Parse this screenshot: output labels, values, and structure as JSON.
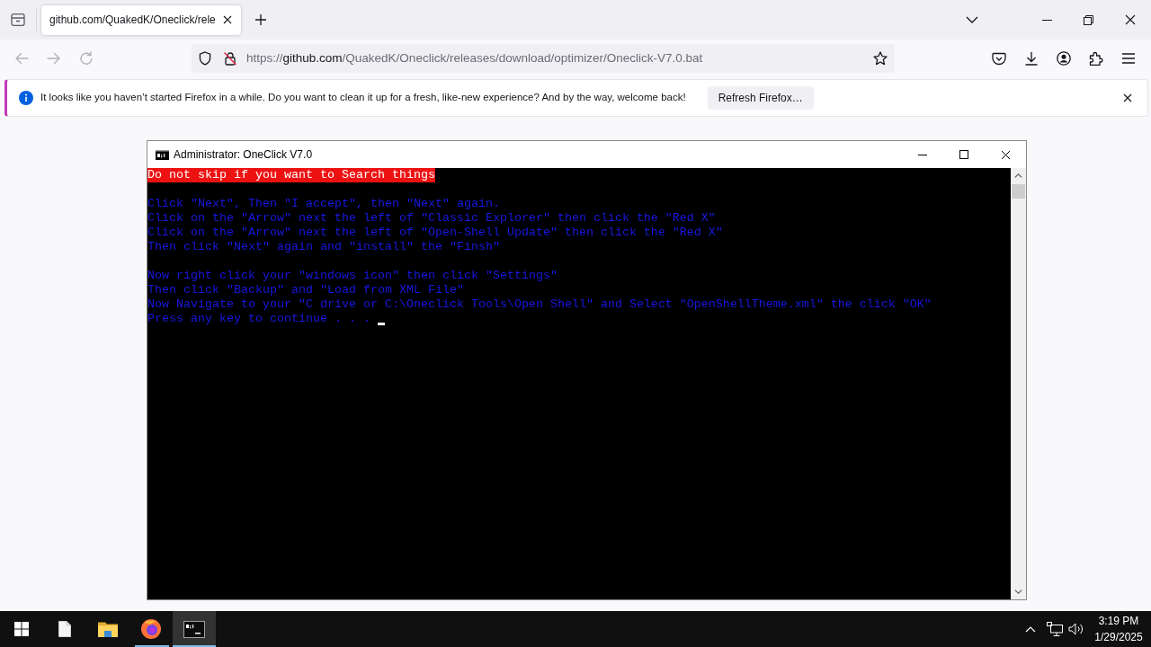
{
  "browser": {
    "tabs": [
      {
        "label": "github.com/QuakedK/Oneclick/rele",
        "selected": true
      }
    ],
    "nav_buttons": [
      {
        "kind": "back",
        "disabled": true
      },
      {
        "kind": "forward",
        "disabled": true
      },
      {
        "kind": "reload",
        "disabled": true
      }
    ],
    "address_bar": {
      "scheme": "https://",
      "host": "github.com",
      "path": "/QuakedK/Oneclick/releases/download/optimizer/Oneclick-V7.0.bat"
    },
    "notification": {
      "message": "It looks like you haven’t started Firefox in a while. Do you want to clean it up for a fresh, like-new experience? And by the way, welcome back!",
      "button": "Refresh Firefox…"
    }
  },
  "console_window": {
    "title": "Administrator: OneClick V7.0",
    "cursor": true,
    "lines": [
      {
        "kind": "highlight",
        "text": "Do not skip if you want to Search things"
      },
      {
        "kind": "blank"
      },
      {
        "kind": "text",
        "text": "Click \"Next\", Then \"I accept\", then \"Next\" again."
      },
      {
        "kind": "text",
        "text": "Click on the \"Arrow\" next the left of \"Classic Explorer\" then click the \"Red X\""
      },
      {
        "kind": "text",
        "text": "Click on the \"Arrow\" next the left of \"Open-Shell Update\" then click the \"Red X\""
      },
      {
        "kind": "text",
        "text": "Then click \"Next\" again and \"install\" the \"Finsh\""
      },
      {
        "kind": "blank"
      },
      {
        "kind": "text",
        "text": "Now right click your \"windows icon\" then click \"Settings\""
      },
      {
        "kind": "text",
        "text": "Then click \"Backup\" and \"Load from XML File\""
      },
      {
        "kind": "text",
        "text": "Now Navigate to your \"C drive or C:\\Oneclick Tools\\Open Shell\" and Select \"OpenShellTheme.xml\" the click \"OK\""
      },
      {
        "kind": "text",
        "text": "Press any key to continue . . ."
      }
    ]
  },
  "taskbar": {
    "apps": [
      {
        "kind": "document",
        "running": false,
        "selected": false
      },
      {
        "kind": "folder",
        "running": false,
        "selected": false
      },
      {
        "kind": "browser",
        "running": true,
        "selected": false
      },
      {
        "kind": "terminal",
        "running": true,
        "selected": true
      }
    ],
    "time": "3:19 PM",
    "date": "1/29/2025"
  }
}
